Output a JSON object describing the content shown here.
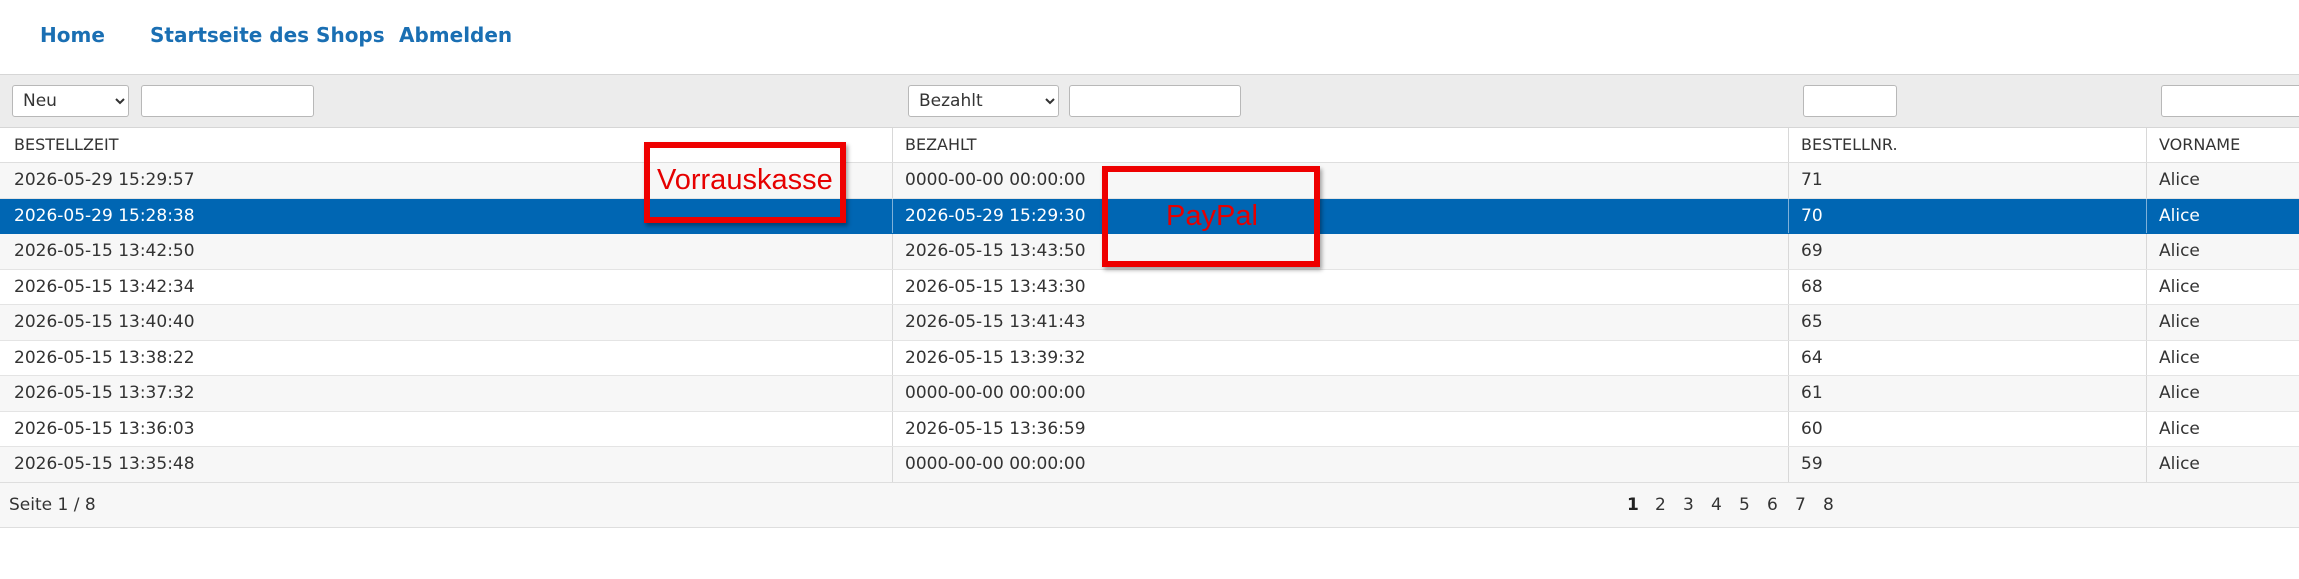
{
  "nav": {
    "home": "Home",
    "shop_start": "Startseite des Shops",
    "logout": "Abmelden"
  },
  "filters": {
    "status_selected": "Neu",
    "status_options": [
      "Neu"
    ],
    "bezahlt_selected": "Bezahlt",
    "bezahlt_options": [
      "Bezahlt"
    ]
  },
  "columns": [
    "BESTELLZEIT",
    "BEZAHLT",
    "BESTELLNR.",
    "VORNAME"
  ],
  "rows": [
    {
      "bestellzeit": "2026-05-29 15:29:57",
      "bezahlt": "0000-00-00 00:00:00",
      "bestellnr": "71",
      "vorname": "Alice"
    },
    {
      "bestellzeit": "2026-05-29 15:28:38",
      "bezahlt": "2026-05-29 15:29:30",
      "bestellnr": "70",
      "vorname": "Alice"
    },
    {
      "bestellzeit": "2026-05-15 13:42:50",
      "bezahlt": "2026-05-15 13:43:50",
      "bestellnr": "69",
      "vorname": "Alice"
    },
    {
      "bestellzeit": "2026-05-15 13:42:34",
      "bezahlt": "2026-05-15 13:43:30",
      "bestellnr": "68",
      "vorname": "Alice"
    },
    {
      "bestellzeit": "2026-05-15 13:40:40",
      "bezahlt": "2026-05-15 13:41:43",
      "bestellnr": "65",
      "vorname": "Alice"
    },
    {
      "bestellzeit": "2026-05-15 13:38:22",
      "bezahlt": "2026-05-15 13:39:32",
      "bestellnr": "64",
      "vorname": "Alice"
    },
    {
      "bestellzeit": "2026-05-15 13:37:32",
      "bezahlt": "0000-00-00 00:00:00",
      "bestellnr": "61",
      "vorname": "Alice"
    },
    {
      "bestellzeit": "2026-05-15 13:36:03",
      "bezahlt": "2026-05-15 13:36:59",
      "bestellnr": "60",
      "vorname": "Alice"
    },
    {
      "bestellzeit": "2026-05-15 13:35:48",
      "bezahlt": "0000-00-00 00:00:00",
      "bestellnr": "59",
      "vorname": "Alice"
    }
  ],
  "selected_row": 1,
  "pager": {
    "info": "Seite 1 / 8",
    "pages": [
      "1",
      "2",
      "3",
      "4",
      "5",
      "6",
      "7",
      "8"
    ],
    "current": "1"
  },
  "annotations": {
    "vorrauskasse": "Vorrauskasse",
    "paypal": "PayPal"
  },
  "colors": {
    "link": "#1a6fb3",
    "selected_row": "#0066b3",
    "annotation": "#ee0000"
  }
}
